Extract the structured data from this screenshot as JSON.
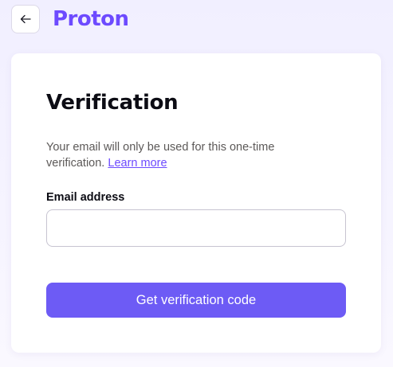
{
  "header": {
    "back_icon": "arrow-left-icon",
    "logo_text": "Proton",
    "brand_color": "#6d4aff"
  },
  "form": {
    "title": "Verification",
    "description": "Your email will only be used for this one-time verification.",
    "learn_more_label": "Learn more",
    "email_label": "Email address",
    "email_value": "",
    "email_placeholder": "",
    "submit_label": "Get verification code",
    "button_color": "#6d5bf5"
  }
}
